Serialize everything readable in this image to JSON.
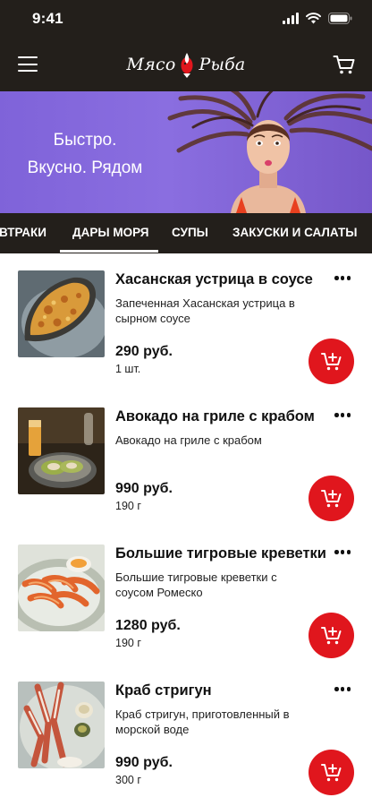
{
  "status_bar": {
    "time": "9:41"
  },
  "header": {
    "logo_left": "Мясо",
    "logo_right": "Рыба",
    "icons": {
      "menu": "hamburger-menu-icon",
      "cart": "shopping-cart-icon"
    }
  },
  "banner": {
    "line1": "Быстро.",
    "line2": "Вкусно. Рядом",
    "background_color": "#8a6ee0"
  },
  "tabs": [
    {
      "label": "ВТРАКИ",
      "active": false
    },
    {
      "label": "ДАРЫ МОРЯ",
      "active": true
    },
    {
      "label": "СУПЫ",
      "active": false
    },
    {
      "label": "ЗАКУСКИ И САЛАТЫ",
      "active": false
    }
  ],
  "products": [
    {
      "name": "Хасанская устрица в соусе",
      "description": "Запеченная Хасанская устрица в сырном соусе",
      "price": "290 руб.",
      "size": "1 шт."
    },
    {
      "name": "Авокадо на гриле с крабом",
      "description": "Авокадо на гриле с крабом",
      "price": "990 руб.",
      "size": "190 г"
    },
    {
      "name": "Большие тигровые креветки",
      "description": "Большие тигровые креветки с соусом Ромеско",
      "price": "1280 руб.",
      "size": "190 г"
    },
    {
      "name": "Краб стригун",
      "description": "Краб стригун, приготовленный в морской воде",
      "price": "990 руб.",
      "size": "300 г"
    }
  ],
  "colors": {
    "dark_bar": "#231f1b",
    "accent": "#e0161d"
  }
}
